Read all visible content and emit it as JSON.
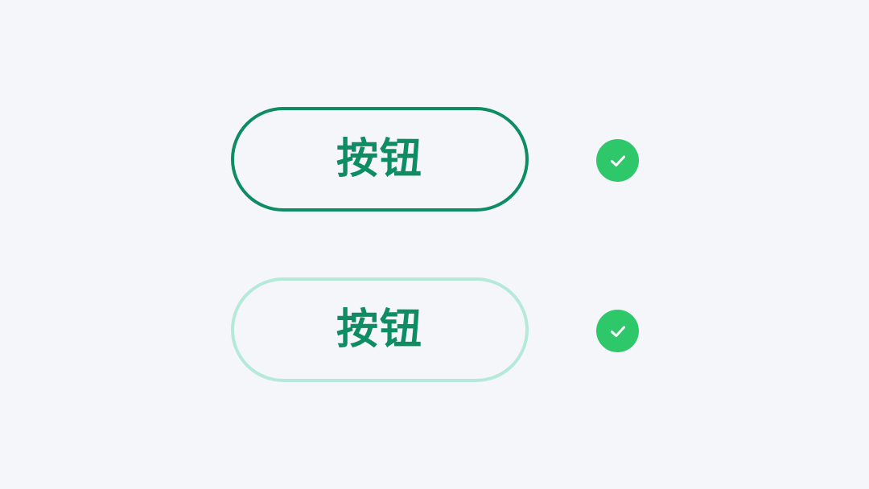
{
  "buttons": [
    {
      "label": "按钮",
      "border_color": "#0e8c62",
      "text_color": "#0e8c62"
    },
    {
      "label": "按钮",
      "border_color": "#b5e9d8",
      "text_color": "#0e8c62"
    }
  ],
  "indicators": [
    {
      "icon": "check-circle-icon",
      "color": "#2ec86b"
    },
    {
      "icon": "check-circle-icon",
      "color": "#2ec86b"
    }
  ],
  "colors": {
    "background": "#f4f6f9"
  }
}
